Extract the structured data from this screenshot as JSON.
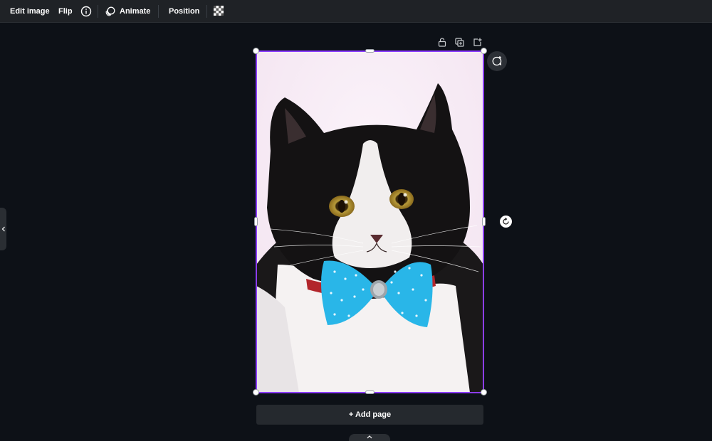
{
  "toolbar": {
    "edit_image": "Edit image",
    "flip": "Flip",
    "info_icon": "info-icon",
    "animate": "Animate",
    "position": "Position",
    "transparency_icon": "checkerboard-icon"
  },
  "page_controls": {
    "icons": [
      "lock-icon",
      "duplicate-icon",
      "add-page-icon"
    ]
  },
  "canvas": {
    "image_description_icon": "cat-photo",
    "comment_icon": "comment-add-icon",
    "rotate_icon": "rotate-icon",
    "add_page_label": "+ Add page"
  },
  "colors": {
    "background": "#0d1117",
    "toolbar": "#1f2226",
    "selection": "#8b3dff",
    "bowtie": "#29b6e8"
  }
}
